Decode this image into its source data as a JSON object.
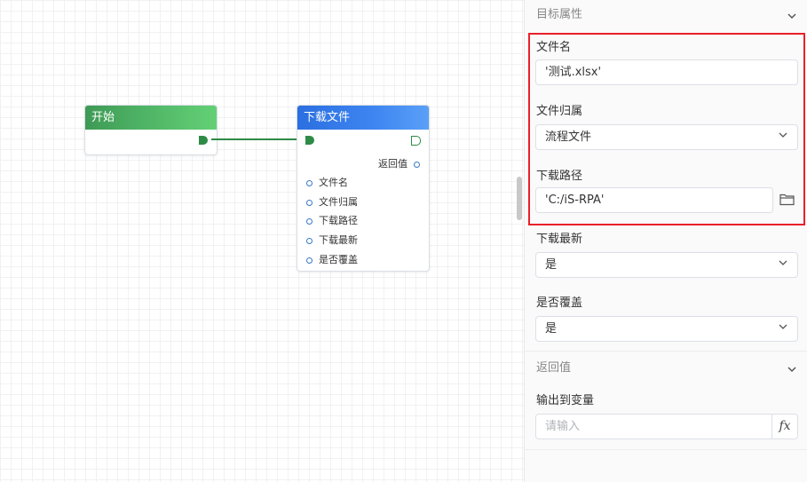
{
  "canvas": {
    "start_node": {
      "title": "开始"
    },
    "download_node": {
      "title": "下载文件",
      "return_label": "返回值",
      "params": [
        "文件名",
        "文件归属",
        "下载路径",
        "下载最新",
        "是否覆盖"
      ]
    }
  },
  "panel": {
    "target_section": {
      "title": "目标属性"
    },
    "filename": {
      "label": "文件名",
      "value": "'测试.xlsx'"
    },
    "file_owner": {
      "label": "文件归属",
      "value": "流程文件"
    },
    "download_path": {
      "label": "下载路径",
      "value": "'C:/iS-RPA'"
    },
    "download_latest": {
      "label": "下载最新",
      "value": "是"
    },
    "overwrite": {
      "label": "是否覆盖",
      "value": "是"
    },
    "return_section": {
      "title": "返回值"
    },
    "output_var": {
      "label": "输出到变量",
      "placeholder": "请输入",
      "fx": "fx"
    }
  },
  "colors": {
    "start_header": "#4fb466",
    "download_header": "#3f86f2",
    "edge": "#2e8b47",
    "highlight": "#e8202a"
  }
}
